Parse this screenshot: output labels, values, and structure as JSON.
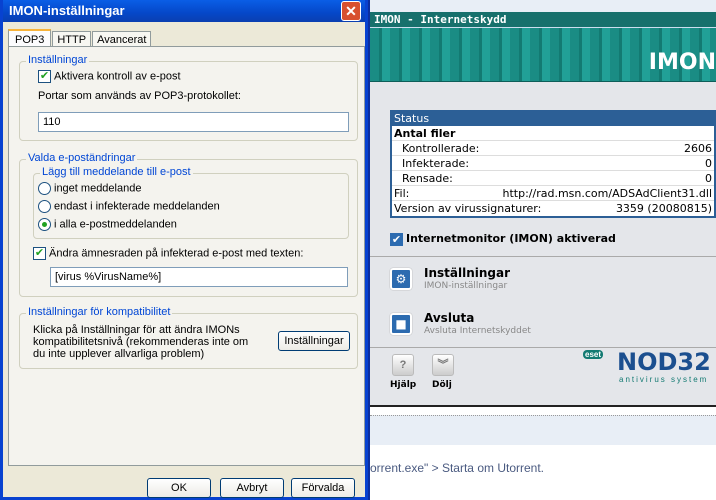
{
  "dialog": {
    "title": "IMON-inställningar",
    "tabs": [
      "POP3",
      "HTTP",
      "Avancerat"
    ],
    "settings": {
      "legend": "Inställningar",
      "enable_label": "Aktivera kontroll av e-post",
      "enable_checked": true,
      "ports_label": "Portar som används av POP3-protokollet:",
      "ports_value": "110"
    },
    "email": {
      "legend": "Valda e-poständringar",
      "sub_legend": "Lägg till meddelande till e-post",
      "options": [
        "inget meddelande",
        "endast i infekterade meddelanden",
        "i alla e-postmeddelanden"
      ],
      "selected": 2,
      "subject_label": "Ändra ämnesraden på infekterad e-post med texten:",
      "subject_checked": true,
      "subject_value": "[virus %VirusName%]"
    },
    "compat": {
      "legend": "Inställningar för kompatibilitet",
      "text1": "Klicka på Inställningar för att ändra IMONs",
      "text2": "kompatibilitetsnivå (rekommenderas inte om",
      "text3": "du inte upplever allvarliga problem)",
      "button": "Inställningar"
    },
    "buttons": {
      "ok": "OK",
      "cancel": "Avbryt",
      "defaults": "Förvalda"
    }
  },
  "imon": {
    "title": "IMON - Internetskydd",
    "banner": "IMON",
    "status": {
      "header": "Status",
      "files_header": "Antal filer",
      "checked_label": "Kontrollerade:",
      "checked": "2606",
      "infected_label": "Infekterade:",
      "infected": "0",
      "cleaned_label": "Rensade:",
      "cleaned": "0",
      "file_label": "Fil:",
      "file": "http://rad.msn.com/ADSAdClient31.dll",
      "version_label": "Version av virussignaturer:",
      "version": "3359 (20080815)"
    },
    "monitor_label": "Internetmonitor (IMON) aktiverad",
    "monitor_checked": true,
    "menu": [
      {
        "title": "Inställningar",
        "sub": "IMON-inställningar"
      },
      {
        "title": "Avsluta",
        "sub": "Avsluta Internetskyddet"
      }
    ],
    "footer": {
      "help": "Hjälp",
      "hide": "Dölj",
      "eset": "eset",
      "brand": "NOD32",
      "brand_sub": "antivirus system"
    }
  },
  "background": {
    "text": "orrent.exe\" > Starta om Utorrent."
  }
}
